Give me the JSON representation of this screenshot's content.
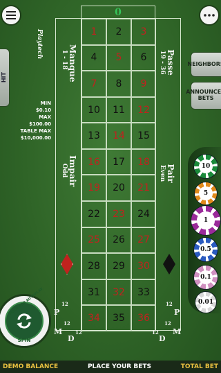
{
  "header": {
    "menu_icon": "hamburger-menu-icon",
    "more_icon": "more-dots-icon"
  },
  "left_button": {
    "label": "HIT"
  },
  "side_buttons": {
    "neighbors": "NEIGHBORS",
    "announced_bets": "ANNOUNCED BETS"
  },
  "table": {
    "logo": "Playtech",
    "zero": "0",
    "zero_color": "#36c45a",
    "red_color": "#c0221e",
    "black_color": "#111111",
    "numbers": [
      {
        "n": "1",
        "c": "red"
      },
      {
        "n": "2",
        "c": "black"
      },
      {
        "n": "3",
        "c": "red"
      },
      {
        "n": "4",
        "c": "black"
      },
      {
        "n": "5",
        "c": "red"
      },
      {
        "n": "6",
        "c": "black"
      },
      {
        "n": "7",
        "c": "red"
      },
      {
        "n": "8",
        "c": "black"
      },
      {
        "n": "9",
        "c": "red"
      },
      {
        "n": "10",
        "c": "black"
      },
      {
        "n": "11",
        "c": "black"
      },
      {
        "n": "12",
        "c": "red"
      },
      {
        "n": "13",
        "c": "black"
      },
      {
        "n": "14",
        "c": "red"
      },
      {
        "n": "15",
        "c": "black"
      },
      {
        "n": "16",
        "c": "red"
      },
      {
        "n": "17",
        "c": "black"
      },
      {
        "n": "18",
        "c": "red"
      },
      {
        "n": "19",
        "c": "red"
      },
      {
        "n": "20",
        "c": "black"
      },
      {
        "n": "21",
        "c": "red"
      },
      {
        "n": "22",
        "c": "black"
      },
      {
        "n": "23",
        "c": "red"
      },
      {
        "n": "24",
        "c": "black"
      },
      {
        "n": "25",
        "c": "red"
      },
      {
        "n": "26",
        "c": "black"
      },
      {
        "n": "27",
        "c": "red"
      },
      {
        "n": "28",
        "c": "black"
      },
      {
        "n": "29",
        "c": "black"
      },
      {
        "n": "30",
        "c": "red"
      },
      {
        "n": "31",
        "c": "black"
      },
      {
        "n": "32",
        "c": "red"
      },
      {
        "n": "33",
        "c": "black"
      },
      {
        "n": "34",
        "c": "red"
      },
      {
        "n": "35",
        "c": "black"
      },
      {
        "n": "36",
        "c": "red"
      }
    ],
    "manque": "Manque",
    "manque_range": "1 - 18",
    "passe": "Passe",
    "passe_range": "19 - 36",
    "impair": "Impair",
    "impair_sub": "Odd",
    "pair": "Pair",
    "pair_sub": "Even",
    "p": "P",
    "m": "M",
    "d": "D",
    "twelve": "12"
  },
  "limits": {
    "min_label": "MIN",
    "min_value": "$0.10",
    "max_label": "MAX",
    "max_value": "$100.00",
    "table_max_label": "TABLE MAX",
    "table_max_value": "$10,000.00"
  },
  "chips": [
    {
      "value": "10",
      "color": "#1a8a3a"
    },
    {
      "value": "5",
      "color": "#e08a1a"
    },
    {
      "value": "1",
      "color": "#9a2a9a"
    },
    {
      "value": "0.5",
      "color": "#2a5ac0"
    },
    {
      "value": "0.1",
      "color": "#d090c0"
    },
    {
      "value": "0.01",
      "color": "#d8d8d8"
    }
  ],
  "spin": {
    "autoplay_hint": "HOLD FOR AUTOPLAY",
    "label": "SPIN"
  },
  "status": {
    "balance_label": "DEMO BALANCE",
    "message": "PLACE YOUR BETS",
    "total_bet_label": "TOTAL BET"
  }
}
